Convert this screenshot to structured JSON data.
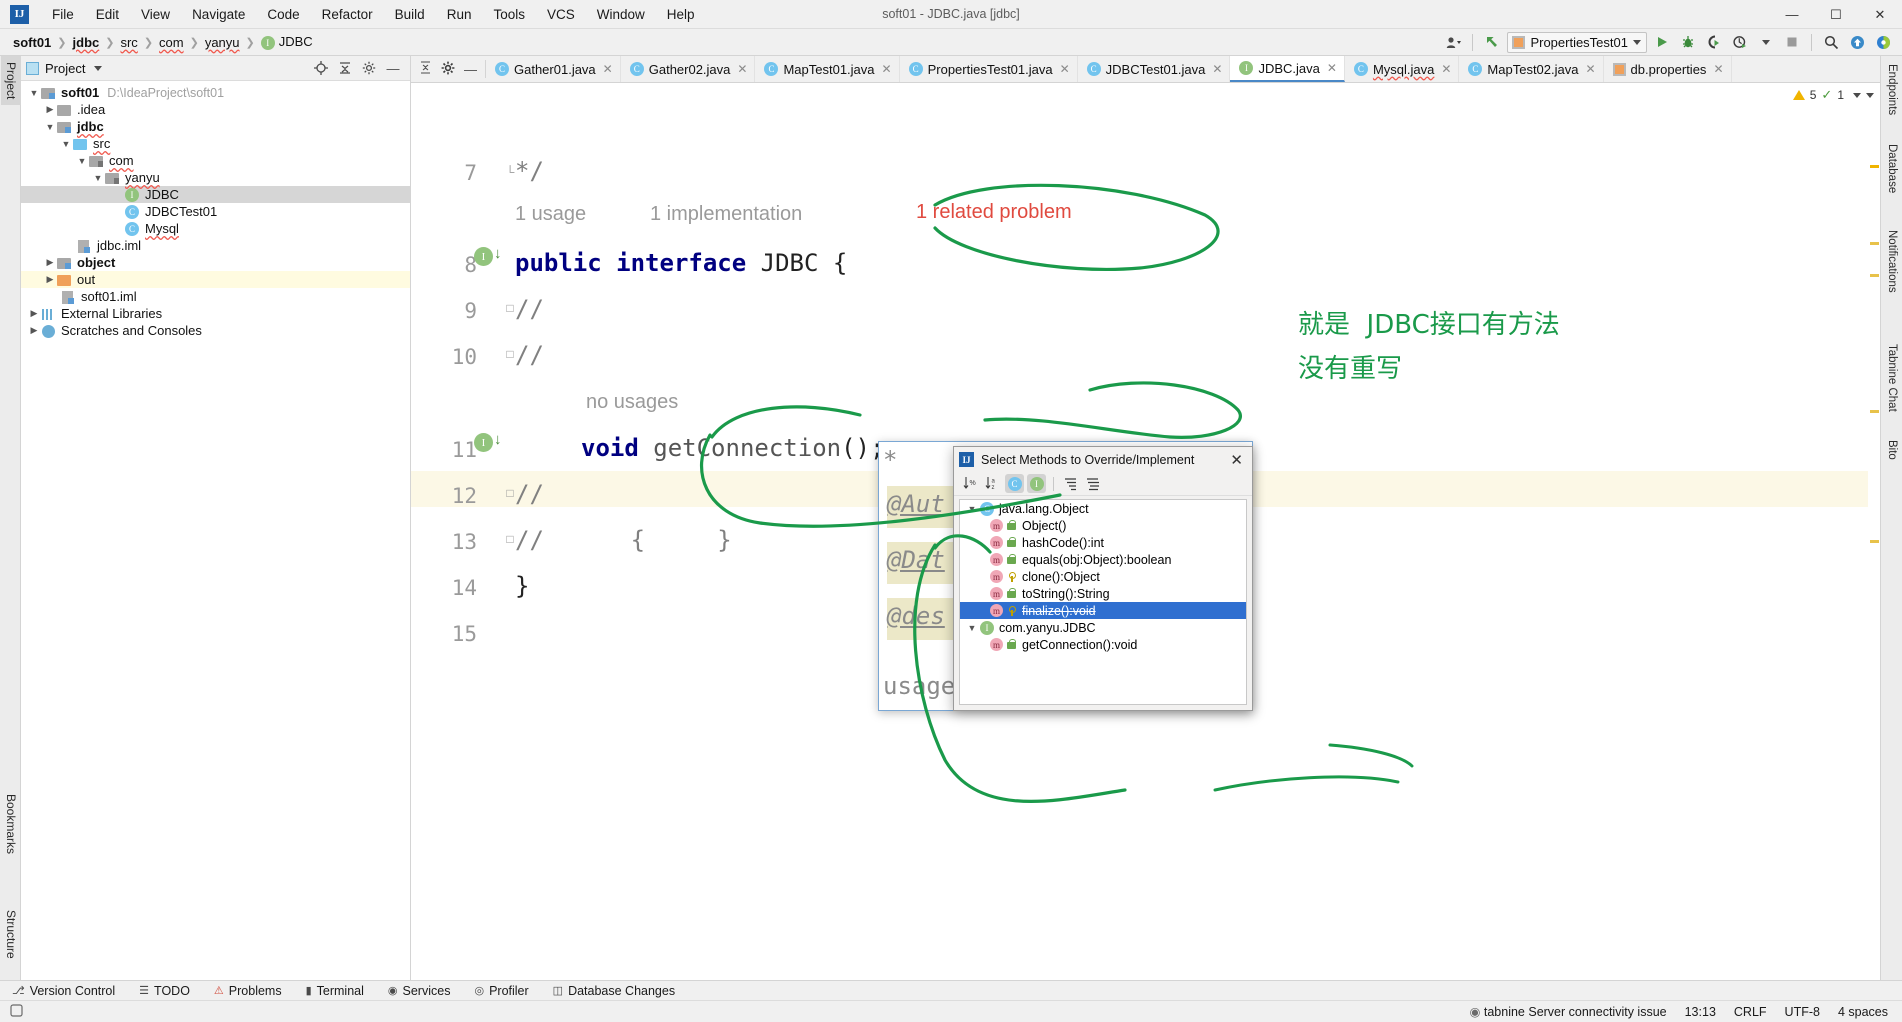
{
  "window": {
    "title": "soft01 - JDBC.java [jdbc]",
    "logo": "IJ",
    "minimize": "—",
    "maximize": "☐",
    "close": "✕"
  },
  "menu": [
    {
      "label": "File"
    },
    {
      "label": "Edit"
    },
    {
      "label": "View"
    },
    {
      "label": "Navigate"
    },
    {
      "label": "Code"
    },
    {
      "label": "Refactor"
    },
    {
      "label": "Build"
    },
    {
      "label": "Run"
    },
    {
      "label": "Tools"
    },
    {
      "label": "VCS"
    },
    {
      "label": "Window"
    },
    {
      "label": "Help"
    }
  ],
  "navbar": {
    "crumbs": [
      {
        "label": "soft01",
        "bold": true,
        "squiggle": false
      },
      {
        "label": "jdbc",
        "bold": true,
        "squiggle": true
      },
      {
        "label": "src",
        "bold": false,
        "squiggle": true
      },
      {
        "label": "com",
        "bold": false,
        "squiggle": true
      },
      {
        "label": "yanyu",
        "bold": false,
        "squiggle": true
      },
      {
        "label": "JDBC",
        "bold": false,
        "squiggle": false,
        "icon": "I"
      }
    ],
    "run_config": "PropertiesTest01",
    "buttons": [
      {
        "name": "user-icon",
        "glyph": "♟"
      },
      {
        "name": "update-project-icon",
        "glyph": "↖"
      },
      {
        "name": "run-button",
        "glyph": "▶"
      },
      {
        "name": "debug-button",
        "glyph": "ὁE"
      },
      {
        "name": "run-with-coverage-button",
        "glyph": "◗"
      },
      {
        "name": "profiler-button",
        "glyph": "⦿"
      },
      {
        "name": "stop-button",
        "glyph": "■"
      },
      {
        "name": "search-icon",
        "glyph": "⌕"
      },
      {
        "name": "updates-icon",
        "glyph": "↑"
      },
      {
        "name": "plugin-icon",
        "glyph": "◖"
      }
    ]
  },
  "left_strip": {
    "tabs": [
      {
        "label": "Project",
        "active": true
      },
      {
        "label": "Bookmarks",
        "active": false
      },
      {
        "label": "Structure",
        "active": false
      }
    ]
  },
  "right_strip": {
    "tabs": [
      {
        "label": "Endpoints"
      },
      {
        "label": "Database"
      },
      {
        "label": "Notifications"
      },
      {
        "label": "Tabnine Chat"
      },
      {
        "label": "Bito"
      }
    ]
  },
  "project_panel": {
    "title": "Project",
    "actions": [
      "locate-icon",
      "collapse-all-icon",
      "settings-icon",
      "hide-icon"
    ],
    "tree": [
      {
        "depth": 0,
        "arrow": "down",
        "icon": "folder",
        "label": "soft01",
        "bold": true,
        "path": "D:\\IdeaProject\\soft01"
      },
      {
        "depth": 1,
        "arrow": "right",
        "icon": "folder-plain",
        "label": ".idea",
        "bold": false
      },
      {
        "depth": 1,
        "arrow": "down",
        "icon": "folder",
        "label": "jdbc",
        "bold": true,
        "squiggle": true
      },
      {
        "depth": 2,
        "arrow": "down",
        "icon": "folder-src",
        "label": "src",
        "bold": false,
        "squiggle": true
      },
      {
        "depth": 3,
        "arrow": "down",
        "icon": "folder-pkg",
        "label": "com",
        "bold": false,
        "squiggle": true
      },
      {
        "depth": 4,
        "arrow": "down",
        "icon": "folder-pkg",
        "label": "yanyu",
        "bold": false,
        "squiggle": true
      },
      {
        "depth": 5,
        "arrow": "none",
        "icon": "cls-i",
        "label": "JDBC",
        "bold": false,
        "selected": true
      },
      {
        "depth": 5,
        "arrow": "none",
        "icon": "cls-c",
        "label": "JDBCTest01",
        "bold": false
      },
      {
        "depth": 5,
        "arrow": "none",
        "icon": "cls-c",
        "label": "Mysql",
        "bold": false,
        "squiggle": true
      },
      {
        "depth": 2,
        "arrow": "none",
        "icon": "iml",
        "label": "jdbc.iml",
        "bold": false
      },
      {
        "depth": 1,
        "arrow": "right",
        "icon": "folder",
        "label": "object",
        "bold": true
      },
      {
        "depth": 1,
        "arrow": "right",
        "icon": "folder-out",
        "label": "out",
        "bold": false,
        "highlight": true
      },
      {
        "depth": 2,
        "arrow": "none",
        "icon": "iml",
        "label": "soft01.iml",
        "bold": false
      },
      {
        "depth": 0,
        "arrow": "right",
        "icon": "lib",
        "label": "External Libraries",
        "bold": false
      },
      {
        "depth": 0,
        "arrow": "right",
        "icon": "scratch",
        "label": "Scratches and Consoles",
        "bold": false
      }
    ]
  },
  "editor": {
    "tabs": [
      {
        "label": "Gather01.java",
        "kind": "class-run",
        "active": false
      },
      {
        "label": "Gather02.java",
        "kind": "class-run",
        "active": false
      },
      {
        "label": "MapTest01.java",
        "kind": "class-run",
        "active": false
      },
      {
        "label": "PropertiesTest01.java",
        "kind": "class-run",
        "active": false
      },
      {
        "label": "JDBCTest01.java",
        "kind": "class",
        "active": false
      },
      {
        "label": "JDBC.java",
        "kind": "interface",
        "active": true
      },
      {
        "label": "Mysql.java",
        "kind": "class",
        "active": false,
        "squiggle": true
      },
      {
        "label": "MapTest02.java",
        "kind": "class-run",
        "active": false
      },
      {
        "label": "db.properties",
        "kind": "properties",
        "active": false
      }
    ],
    "inspection": {
      "warnings": "5",
      "checks": "1"
    },
    "lines": [
      {
        "num": "7",
        "code": "*/",
        "kind": "comment",
        "fold": "end"
      },
      {
        "num": "8",
        "code": "public interface JDBC {",
        "kind": "decl",
        "badge": "I",
        "hintAbove": [
          {
            "text": "1 usage",
            "color": "gray"
          },
          {
            "text": "1 implementation",
            "color": "gray"
          },
          {
            "text": "1 related problem",
            "color": "red"
          }
        ]
      },
      {
        "num": "9",
        "code": "//",
        "kind": "comment",
        "fold": "mark"
      },
      {
        "num": "10",
        "code": "//",
        "kind": "comment",
        "fold": "mark"
      },
      {
        "num": "11",
        "code": "void getConnection();",
        "kind": "method",
        "badge": "I",
        "hintAbove": [
          {
            "text": "no usages",
            "color": "gray"
          }
        ]
      },
      {
        "num": "12",
        "code": "//",
        "kind": "comment",
        "fold": "mark"
      },
      {
        "num": "13",
        "code": "//      {     }",
        "kind": "comment",
        "fold": "mark",
        "current": true
      },
      {
        "num": "14",
        "code": "}",
        "kind": "plain"
      },
      {
        "num": "15",
        "code": "",
        "kind": "plain"
      }
    ]
  },
  "back_dialog": {
    "lines": [
      "*",
      "@Aut",
      "@Dat",
      "@des",
      "/",
      "usage"
    ]
  },
  "dialog": {
    "title": "Select Methods to Override/Implement",
    "close": "✕",
    "toolbar": [
      {
        "name": "sort-by-visibility-icon",
        "glyph": "↓%",
        "active": false
      },
      {
        "name": "sort-alphabetically-icon",
        "glyph": "↓a",
        "active": false
      },
      {
        "name": "show-classes-icon",
        "glyph": "C",
        "active": true
      },
      {
        "name": "show-interfaces-icon",
        "glyph": "I",
        "active": true
      },
      {
        "name": "expand-all-icon",
        "glyph": "≡",
        "active": false
      },
      {
        "name": "collapse-all-icon",
        "glyph": "≢",
        "active": false
      }
    ],
    "tree": [
      {
        "depth": 0,
        "arrow": "down",
        "icon": "cls-c",
        "label": "java.lang.Object"
      },
      {
        "depth": 1,
        "icon": "m",
        "lock": "green",
        "label": "Object()"
      },
      {
        "depth": 1,
        "icon": "m",
        "lock": "green",
        "label": "hashCode():int"
      },
      {
        "depth": 1,
        "icon": "m",
        "lock": "green",
        "label": "equals(obj:Object):boolean"
      },
      {
        "depth": 1,
        "icon": "m",
        "lock": "key",
        "label": "clone():Object"
      },
      {
        "depth": 1,
        "icon": "m",
        "lock": "green",
        "label": "toString():String"
      },
      {
        "depth": 1,
        "icon": "m",
        "lock": "key",
        "label": "finalize():void",
        "selected": true,
        "strike": true
      },
      {
        "depth": 0,
        "arrow": "down",
        "icon": "cls-i",
        "label": "com.yanyu.JDBC"
      },
      {
        "depth": 1,
        "icon": "m",
        "lock": "green",
        "label": "getConnection():void"
      }
    ]
  },
  "annotations": {
    "note1": "就是  JDBC接口有方法",
    "note2": "没有重写",
    "pen_color": "#1a9a4a"
  },
  "bottom_bar": [
    {
      "label": "Version Control",
      "icon": "branch-icon"
    },
    {
      "label": "TODO",
      "icon": "todo-icon"
    },
    {
      "label": "Problems",
      "icon": "problems-icon"
    },
    {
      "label": "Terminal",
      "icon": "terminal-icon"
    },
    {
      "label": "Services",
      "icon": "services-icon"
    },
    {
      "label": "Profiler",
      "icon": "profiler-icon"
    },
    {
      "label": "Database Changes",
      "icon": "db-changes-icon"
    }
  ],
  "status_bar": {
    "left_icon": "git-icon",
    "tabnine": "tabnine Server connectivity issue",
    "position": "13:13",
    "line_sep": "CRLF",
    "encoding": "UTF-8",
    "indent": "4 spaces"
  }
}
